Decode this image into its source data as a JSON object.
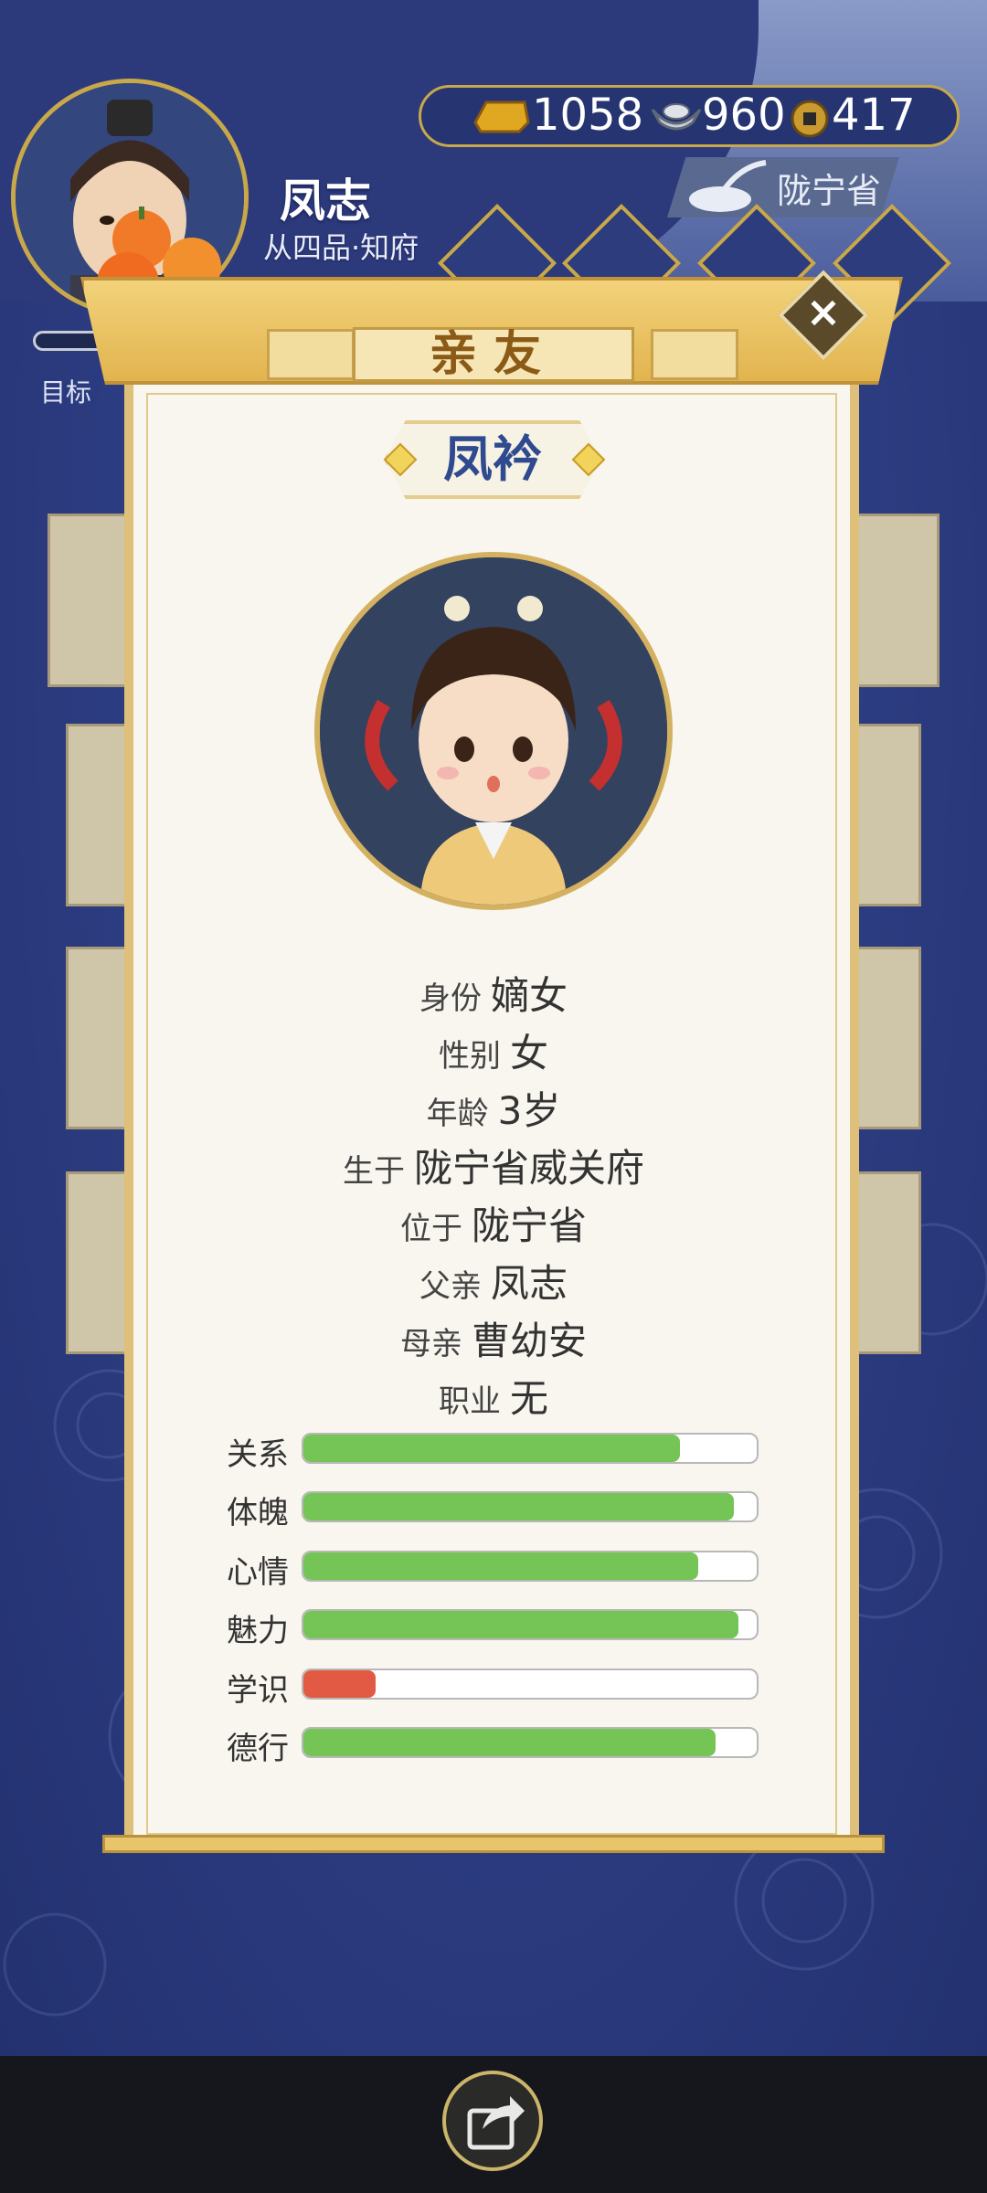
{
  "player": {
    "name": "凤志",
    "rank": "从四品·知府",
    "province": "陇宁省",
    "goal_label": "目标"
  },
  "currency": {
    "gold": "1058",
    "silver": "960",
    "coin": "417"
  },
  "dialog": {
    "title": "亲友",
    "person_name": "凤衿",
    "info": [
      {
        "key": "身份",
        "value": "嫡女"
      },
      {
        "key": "性别",
        "value": "女"
      },
      {
        "key": "年龄",
        "value": "3岁"
      },
      {
        "key": "生于",
        "value": "陇宁省威关府"
      },
      {
        "key": "位于",
        "value": "陇宁省"
      },
      {
        "key": "父亲",
        "value": "凤志"
      },
      {
        "key": "母亲",
        "value": "曹幼安"
      },
      {
        "key": "职业",
        "value": "无"
      }
    ],
    "stats": [
      {
        "label": "关系",
        "fraction": 0.83,
        "color": "#74c456"
      },
      {
        "label": "体魄",
        "fraction": 0.95,
        "color": "#74c456"
      },
      {
        "label": "心情",
        "fraction": 0.87,
        "color": "#74c456"
      },
      {
        "label": "魅力",
        "fraction": 0.96,
        "color": "#74c456"
      },
      {
        "label": "学识",
        "fraction": 0.16,
        "color": "#e25a44"
      },
      {
        "label": "德行",
        "fraction": 0.91,
        "color": "#74c456"
      }
    ]
  },
  "icons": {
    "close": "close-icon",
    "share": "share-icon",
    "gold": "gold-ingot-icon",
    "silver": "silver-ingot-icon",
    "coin": "copper-coin-icon"
  },
  "colors": {
    "accent_gold": "#c9a84a",
    "name_blue": "#2f4a8e",
    "bar_green": "#74c456",
    "bar_red": "#e25a44"
  }
}
